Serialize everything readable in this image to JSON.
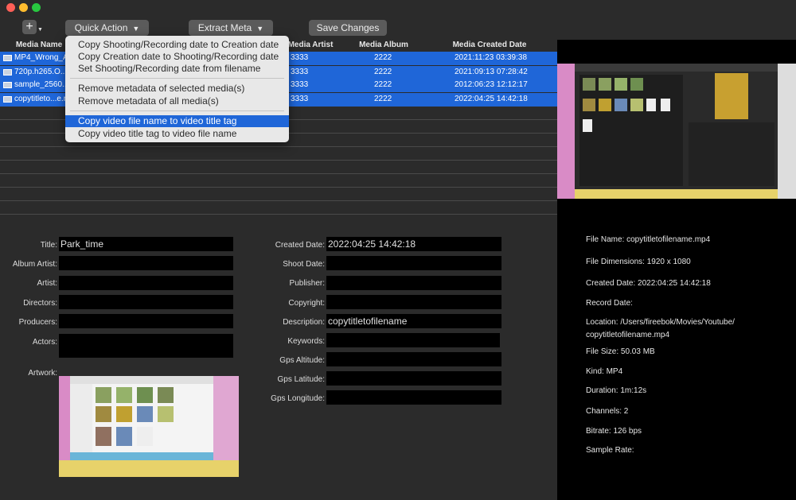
{
  "toolbar": {
    "add_symbol": "+",
    "quick_action_label": "Quick Action",
    "extract_meta_label": "Extract Meta",
    "save_changes_label": "Save Changes"
  },
  "table": {
    "columns": [
      "Media Name",
      "Media Artist",
      "Media Album",
      "Media Created Date"
    ],
    "rows": [
      {
        "name": "MP4_Wrong_A...",
        "artist": "3333",
        "album": "2222",
        "date": "2021:11:23 03:39:38"
      },
      {
        "name": "720p.h265.O...L",
        "artist": "3333",
        "album": "2222",
        "date": "2021:09:13 07:28:42"
      },
      {
        "name": "sample_2560...O",
        "artist": "3333",
        "album": "2222",
        "date": "2012:06:23 12:12:17"
      },
      {
        "name": "copytitleto...e.mp",
        "artist": "3333",
        "album": "2222",
        "date": "2022:04:25 14:42:18"
      }
    ]
  },
  "menu": {
    "items": [
      "Copy Shooting/Recording date to Creation date",
      "Copy Creation date to Shooting/Recording date",
      "Set Shooting/Recording date from filename",
      "Remove metadata of selected media(s)",
      "Remove metadata of all media(s)",
      "Copy video file name to video title tag",
      "Copy video title tag to video file name"
    ]
  },
  "form": {
    "left": [
      {
        "label": "Title:",
        "value": "Park_time"
      },
      {
        "label": "Album Artist:",
        "value": ""
      },
      {
        "label": "Artist:",
        "value": ""
      },
      {
        "label": "Directors:",
        "value": ""
      },
      {
        "label": "Producers:",
        "value": ""
      },
      {
        "label": "Actors:",
        "value": ""
      }
    ],
    "artwork_label": "Artwork:",
    "right": [
      {
        "label": "Created Date:",
        "value": "2022:04:25 14:42:18"
      },
      {
        "label": "Shoot Date:",
        "value": ""
      },
      {
        "label": "Publisher:",
        "value": ""
      },
      {
        "label": "Copyright:",
        "value": ""
      },
      {
        "label": "Description:",
        "value": "copytitletofilename"
      },
      {
        "label": "Keywords:",
        "value": ""
      },
      {
        "label": "Gps Altitude:",
        "value": ""
      },
      {
        "label": "Gps Latitude:",
        "value": ""
      },
      {
        "label": "Gps Longitude:",
        "value": ""
      }
    ]
  },
  "info": {
    "file_name": "File Name: copytitletofilename.mp4",
    "dimensions": "File Dimensions: 1920 x 1080",
    "created": "Created Date: 2022:04:25 14:42:18",
    "record": "Record Date:",
    "location_1": "Location: /Users/fireebok/Movies/Youtube/",
    "location_2": "copytitletofilename.mp4",
    "size": "File Size: 50.03 MB",
    "kind": "Kind: MP4",
    "duration": "Duration: 1m:12s",
    "channels": "Channels: 2",
    "bitrate": "Bitrate: 126 bps",
    "sample_rate": "Sample Rate:"
  },
  "colors": {
    "selection": "#1f66d8",
    "background": "#2b2b2b",
    "field": "#000000"
  }
}
